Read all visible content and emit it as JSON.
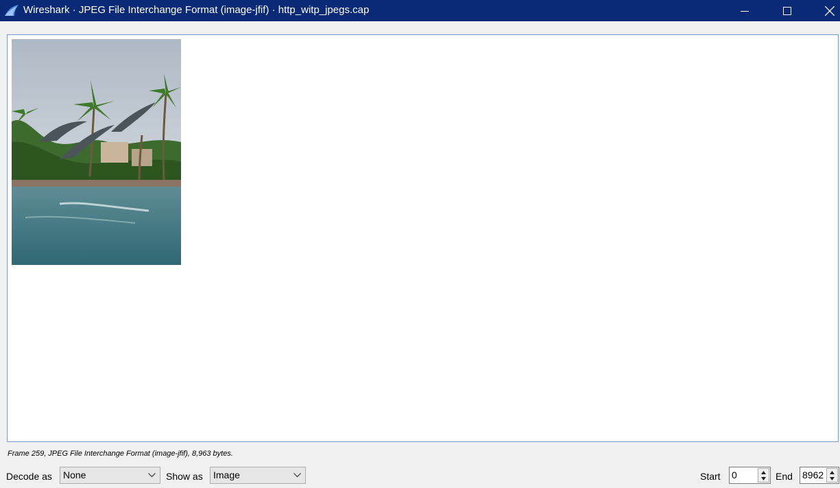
{
  "window": {
    "title": "Wireshark · JPEG File Interchange Format (image-jfif) · http_witp_jpegs.cap",
    "titlebar_color": "#0a2a78",
    "icon": "wireshark-fin-icon"
  },
  "viewer": {
    "image_description_icon": "jpeg-image",
    "border_color": "#7a9ccf"
  },
  "status": {
    "frame_info": "Frame 259, JPEG File Interchange Format (image-jfif), 8,963 bytes."
  },
  "controls": {
    "decode_as_label": "Decode as",
    "decode_as_value": "None",
    "show_as_label": "Show as",
    "show_as_value": "Image",
    "start_label": "Start",
    "start_value": "0",
    "end_label": "End",
    "end_value": "8962"
  }
}
